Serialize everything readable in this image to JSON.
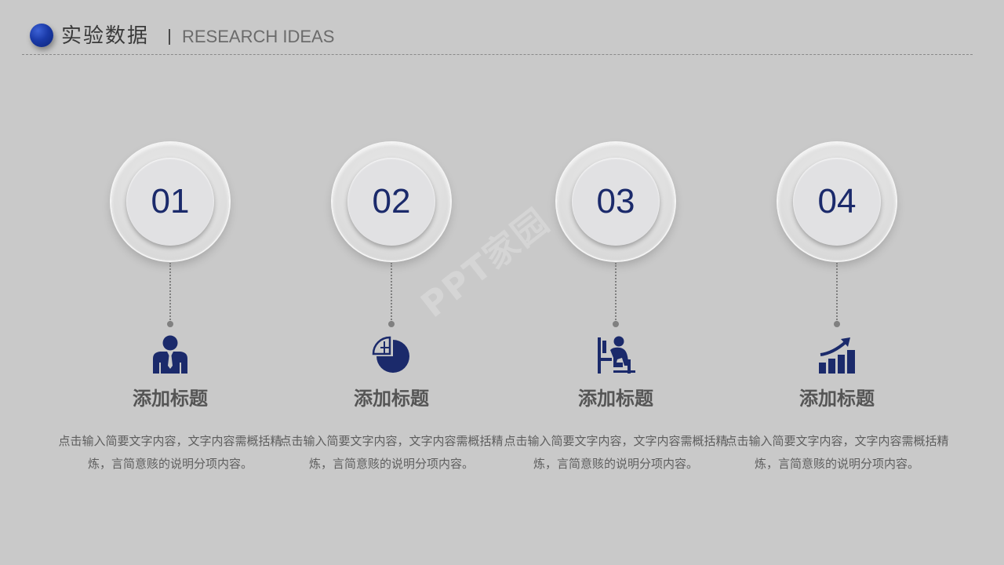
{
  "header": {
    "title": "实验数据",
    "subtitle": "RESEARCH IDEAS"
  },
  "watermark": "PPT家园",
  "colors": {
    "accent": "#1b2a6b",
    "background": "#c9c9c9"
  },
  "items": [
    {
      "number": "01",
      "icon": "businessman-icon",
      "title": "添加标题",
      "desc": "点击输入简要文字内容，文字内容需概括精炼，言简意赅的说明分项内容。"
    },
    {
      "number": "02",
      "icon": "pie-chart-icon",
      "title": "添加标题",
      "desc": "点击输入简要文字内容，文字内容需概括精炼，言简意赅的说明分项内容。"
    },
    {
      "number": "03",
      "icon": "person-at-desk-icon",
      "title": "添加标题",
      "desc": "点击输入简要文字内容，文字内容需概括精炼，言简意赅的说明分项内容。"
    },
    {
      "number": "04",
      "icon": "growth-chart-icon",
      "title": "添加标题",
      "desc": "点击输入简要文字内容，文字内容需概括精炼，言简意赅的说明分项内容。"
    }
  ]
}
